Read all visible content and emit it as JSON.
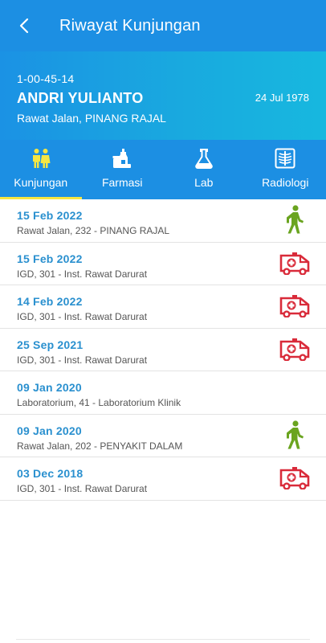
{
  "header": {
    "title": "Riwayat Kunjungan"
  },
  "patient": {
    "id": "1-00-45-14",
    "name": "ANDRI YULIANTO",
    "unit": "Rawat Jalan, PINANG RAJAL",
    "dob": "24 Jul 1978"
  },
  "tabs": [
    {
      "label": "Kunjungan",
      "icon": "people-icon",
      "active": true
    },
    {
      "label": "Farmasi",
      "icon": "pharmacy-icon",
      "active": false
    },
    {
      "label": "Lab",
      "icon": "flask-icon",
      "active": false
    },
    {
      "label": "Radiologi",
      "icon": "xray-icon",
      "active": false
    }
  ],
  "visits": [
    {
      "date": "15 Feb 2022",
      "desc": "Rawat Jalan, 232 - PINANG RAJAL",
      "icon": "walking-person-icon"
    },
    {
      "date": "15 Feb 2022",
      "desc": "IGD, 301 - Inst. Rawat Darurat",
      "icon": "ambulance-icon"
    },
    {
      "date": "14 Feb 2022",
      "desc": "IGD, 301 - Inst. Rawat Darurat",
      "icon": "ambulance-icon"
    },
    {
      "date": "25 Sep 2021",
      "desc": "IGD, 301 - Inst. Rawat Darurat",
      "icon": "ambulance-icon"
    },
    {
      "date": "09 Jan 2020",
      "desc": "Laboratorium, 41 - Laboratorium Klinik",
      "icon": ""
    },
    {
      "date": "09 Jan 2020",
      "desc": "Rawat Jalan, 202 - PENYAKIT DALAM",
      "icon": "walking-person-icon"
    },
    {
      "date": "03 Dec 2018",
      "desc": "IGD, 301 - Inst. Rawat Darurat",
      "icon": "ambulance-icon"
    }
  ],
  "colors": {
    "primary": "#1c8fe3",
    "accent": "#f5e642",
    "walk": "#6aa41f",
    "ambulance": "#d92b3a",
    "date": "#2a90cf"
  }
}
